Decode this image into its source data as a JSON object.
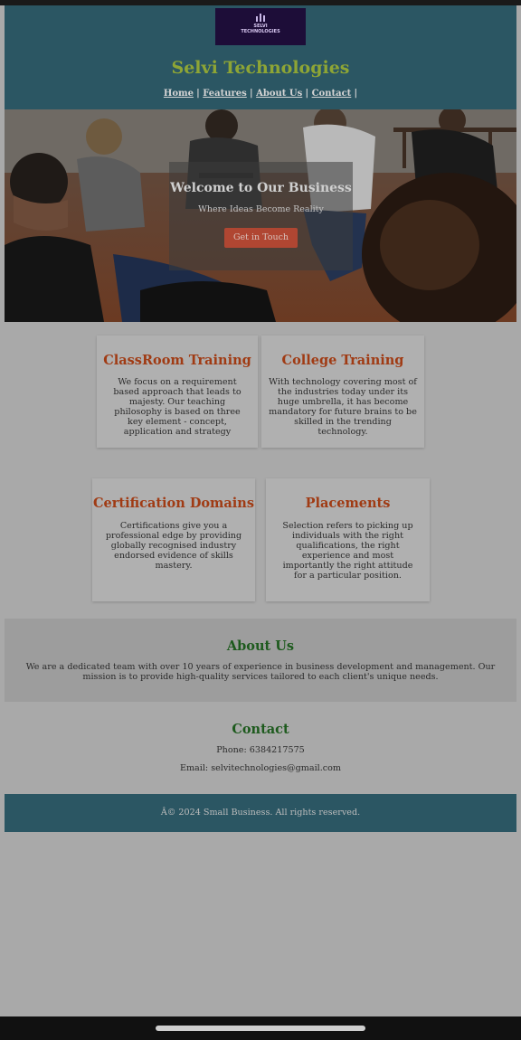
{
  "header": {
    "logo_text": "SELVI\nTECHNOLOGIES",
    "site_title": "Selvi Technologies",
    "nav": [
      "Home",
      "Features",
      "About Us",
      "Contact"
    ]
  },
  "hero": {
    "title": "Welcome to Our Business",
    "subtitle": "Where Ideas Become Reality",
    "button": "Get in Touch"
  },
  "features": [
    {
      "title": "ClassRoom Training",
      "text": "We focus on a requirement based approach that leads to majesty. Our teaching philosophy is based on three key element - concept, application and strategy"
    },
    {
      "title": "College Training",
      "text": "With technology covering most of the industries today under its huge umbrella, it has become mandatory for future brains to be skilled in the trending technology."
    },
    {
      "title": "Certification Domains",
      "text": "Certifications give you a professional edge by providing globally recognised industry endorsed evidence of skills mastery."
    },
    {
      "title": "Placements",
      "text": "Selection refers to picking up individuals with the right qualifications, the right experience and most importantly the right attitude for a particular position."
    }
  ],
  "about": {
    "title": "About Us",
    "text": "We are a dedicated team with over 10 years of experience in business development and management. Our mission is to provide high-quality services tailored to each client's unique needs."
  },
  "contact": {
    "title": "Contact",
    "phone": "Phone: 6384217575",
    "email": "Email: selvitechnologies@gmail.com"
  },
  "footer": {
    "text": "Â© 2024 Small Business. All rights reserved."
  }
}
